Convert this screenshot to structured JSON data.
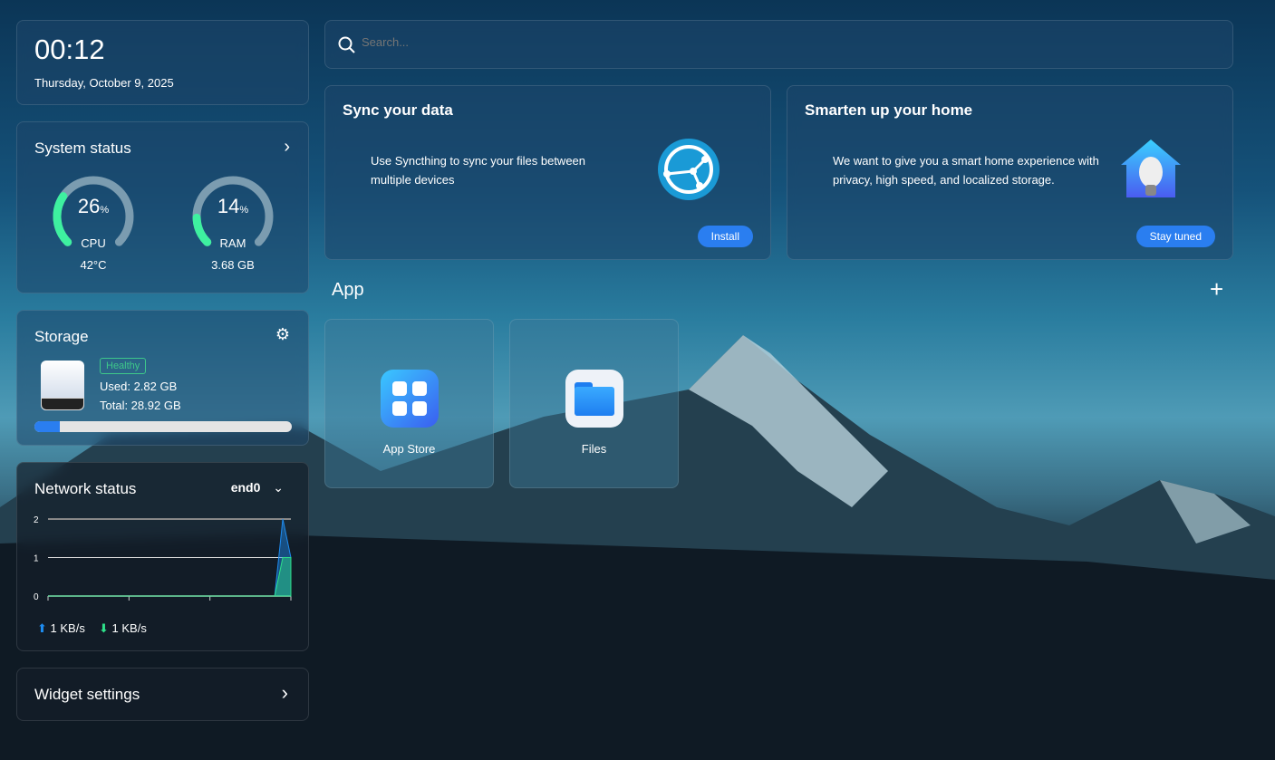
{
  "clock": {
    "time": "00:12",
    "date": "Thursday, October 9, 2025"
  },
  "system_status": {
    "title": "System status",
    "cpu": {
      "value": 26,
      "value_text": "26",
      "unit": "%",
      "label": "CPU",
      "sub": "42°C"
    },
    "ram": {
      "value": 14,
      "value_text": "14",
      "unit": "%",
      "label": "RAM",
      "sub": "3.68 GB"
    }
  },
  "storage": {
    "title": "Storage",
    "badge": "Healthy",
    "used": "Used: 2.82 GB",
    "total": "Total: 28.92 GB",
    "used_fraction": 0.0975
  },
  "network": {
    "title": "Network status",
    "interface": "end0",
    "upload": "1 KB/s",
    "download": "1 KB/s"
  },
  "widget_settings": {
    "label": "Widget settings"
  },
  "search": {
    "placeholder": "Search..."
  },
  "cards": [
    {
      "title": "Sync your data",
      "text": "Use Syncthing to sync your files between multiple devices",
      "button": "Install"
    },
    {
      "title": "Smarten up your home",
      "text": "We want to give you a smart home experience with privacy, high speed, and localized storage.",
      "button": "Stay tuned"
    }
  ],
  "apps": {
    "heading": "App",
    "items": [
      {
        "name": "App Store"
      },
      {
        "name": "Files"
      }
    ]
  },
  "colors": {
    "accent": "#2a7ef0",
    "gauge": "#3ef0a0",
    "upload": "#1e8cf0",
    "download": "#2ee08a"
  },
  "chart_data": {
    "type": "area",
    "y_ticks": [
      "0",
      "1",
      "2"
    ],
    "ylim": [
      0,
      2
    ],
    "series": [
      {
        "name": "upload",
        "values": [
          0,
          0,
          0,
          0,
          0,
          0,
          0,
          0,
          0,
          0,
          0,
          0,
          0,
          0,
          0,
          0,
          0,
          0,
          0,
          0,
          0,
          0,
          0,
          0,
          0,
          0,
          0,
          0,
          0,
          2,
          1
        ]
      },
      {
        "name": "download",
        "values": [
          0,
          0,
          0,
          0,
          0,
          0,
          0,
          0,
          0,
          0,
          0,
          0,
          0,
          0,
          0,
          0,
          0,
          0,
          0,
          0,
          0,
          0,
          0,
          0,
          0,
          0,
          0,
          0,
          0,
          1,
          1
        ]
      }
    ]
  }
}
